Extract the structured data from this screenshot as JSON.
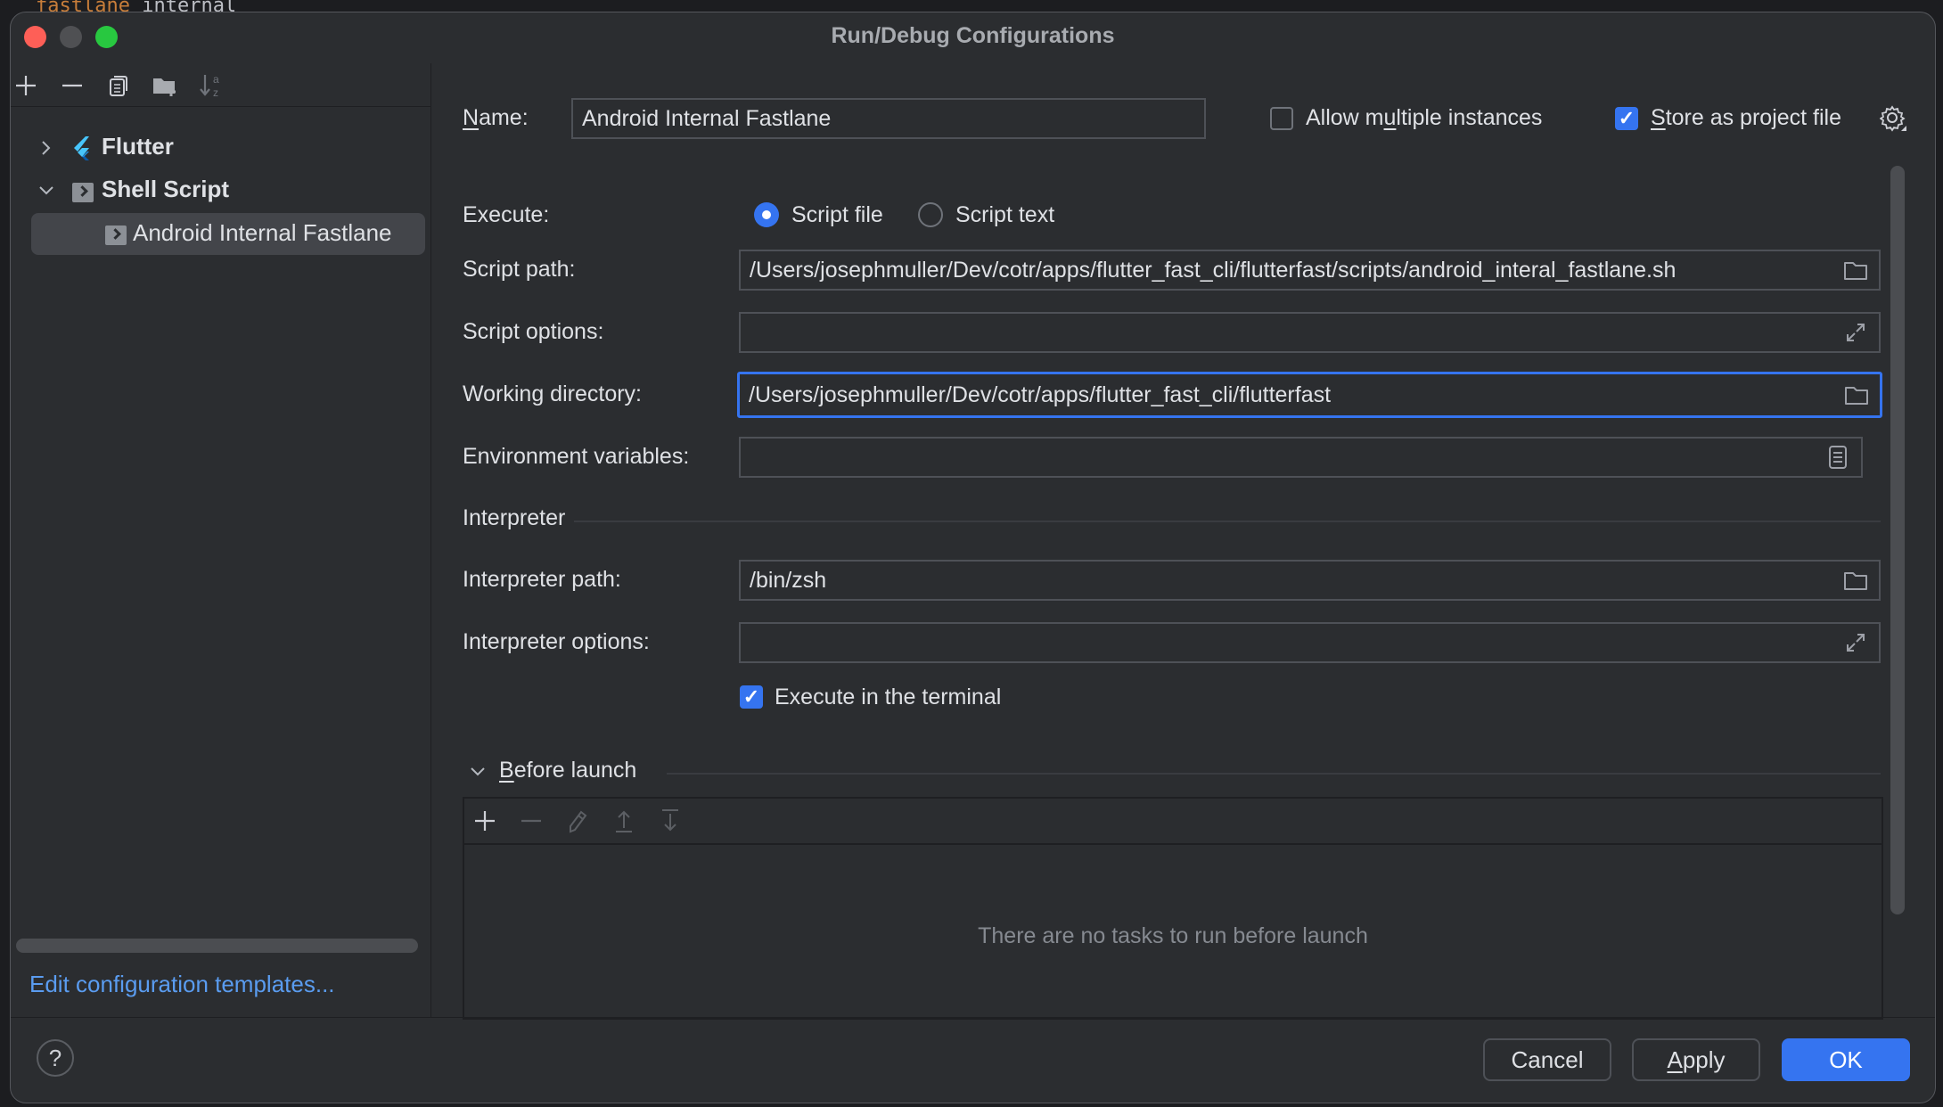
{
  "background": {
    "code_fragment_a": "fastlane",
    "code_fragment_b": "internal"
  },
  "window": {
    "title": "Run/Debug Configurations"
  },
  "sidebar": {
    "toolbar": [
      {
        "name": "add-icon",
        "label": "Add"
      },
      {
        "name": "remove-icon",
        "label": "Remove"
      },
      {
        "name": "copy-icon",
        "label": "Copy"
      },
      {
        "name": "new-folder-icon",
        "label": "New folder"
      },
      {
        "name": "sort-icon",
        "label": "Sort"
      }
    ],
    "tree": [
      {
        "label": "Flutter",
        "expanded": false,
        "icon": "flutter-icon"
      },
      {
        "label": "Shell Script",
        "expanded": true,
        "icon": "shell-script-icon"
      },
      {
        "label": "Android Internal Fastlane",
        "selected": true,
        "icon": "shell-script-icon"
      }
    ],
    "templates_link": "Edit configuration templates..."
  },
  "form": {
    "name_label": "Name:",
    "name_value": "Android Internal Fastlane",
    "allow_multiple_label": "Allow multiple instances",
    "allow_multiple_checked": false,
    "store_label": "Store as project file",
    "store_checked": true,
    "execute_label": "Execute:",
    "execute_options": [
      "Script file",
      "Script text"
    ],
    "execute_selected": "Script file",
    "script_path_label": "Script path:",
    "script_path_value": "/Users/josephmuller/Dev/cotr/apps/flutter_fast_cli/flutterfast/scripts/android_interal_fastlane.sh",
    "script_options_label": "Script options:",
    "script_options_value": "",
    "working_dir_label": "Working directory:",
    "working_dir_value": "/Users/josephmuller/Dev/cotr/apps/flutter_fast_cli/flutterfast",
    "env_label": "Environment variables:",
    "env_value": "",
    "interpreter_section": "Interpreter",
    "interp_path_label": "Interpreter path:",
    "interp_path_value": "/bin/zsh",
    "interp_options_label": "Interpreter options:",
    "interp_options_value": "",
    "terminal_label": "Execute in the terminal",
    "terminal_checked": true
  },
  "before_launch": {
    "title": "Before launch",
    "toolbar": [
      "add-icon",
      "remove-icon",
      "edit-icon",
      "move-up-icon",
      "move-down-icon"
    ],
    "empty_text": "There are no tasks to run before launch"
  },
  "footer": {
    "help": "?",
    "cancel": "Cancel",
    "apply": "Apply",
    "ok": "OK"
  },
  "colors": {
    "accent": "#3574f0",
    "link": "#5a9cf0",
    "background": "#2b2d30"
  }
}
